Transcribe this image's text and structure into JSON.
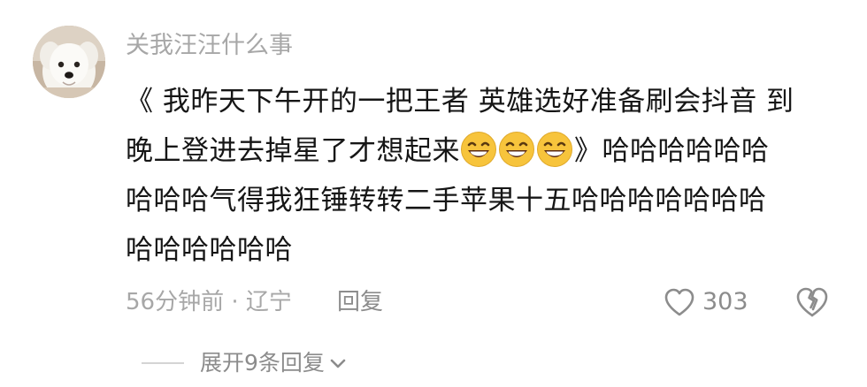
{
  "comment": {
    "username": "关我汪汪什么事",
    "lines": [
      "《 我昨天下午开的一把王者 英雄选好准备刷会抖音 到",
      "晚上登进去掉星了才想起来",
      "》哈哈哈哈哈哈",
      "哈哈哈气得我狂锤转转二手苹果十五哈哈哈哈哈哈哈",
      "哈哈哈哈哈哈"
    ],
    "emoji_icon": "grinning-face-icon",
    "emoji_count": 3,
    "time_location": "56分钟前 · 辽宁",
    "reply_label": "回复",
    "like_count": "303",
    "expand_label": "展开9条回复"
  },
  "colors": {
    "text_primary": "#161616",
    "text_secondary": "#a7a7a7",
    "action_gray": "#8c8c8c",
    "emoji_yellow": "#f7c43c"
  }
}
